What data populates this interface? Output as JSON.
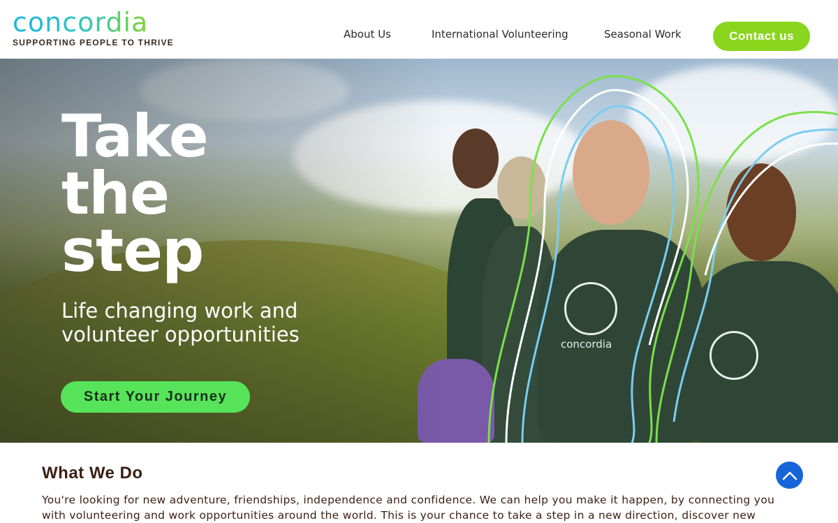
{
  "brand": {
    "name": "concordia",
    "tagline": "SUPPORTING PEOPLE TO THRIVE"
  },
  "nav": {
    "items": [
      {
        "label": "About Us"
      },
      {
        "label": "International Volunteering"
      },
      {
        "label": "Seasonal Work"
      }
    ],
    "contact_label": "Contact us"
  },
  "hero": {
    "title_lines": [
      "Take",
      "the",
      "step"
    ],
    "subtitle": "Life changing work and volunteer opportunities",
    "cta_label": "Start Your Journey",
    "shirt_text": "concordia"
  },
  "what_we_do": {
    "title": "What We Do",
    "text": "You're looking for new adventure, friendships, independence and confidence. We can help you make it happen, by connecting you with volunteering and work opportunities around the world. This is your chance to take a step in a new direction, discover new"
  },
  "icons": {
    "scroll_top": "chevron-up-icon"
  },
  "colors": {
    "brand_green": "#8ad61e",
    "cta_green": "#57e45a",
    "scroll_blue": "#1565d8",
    "text_brown": "#3a1f14"
  }
}
